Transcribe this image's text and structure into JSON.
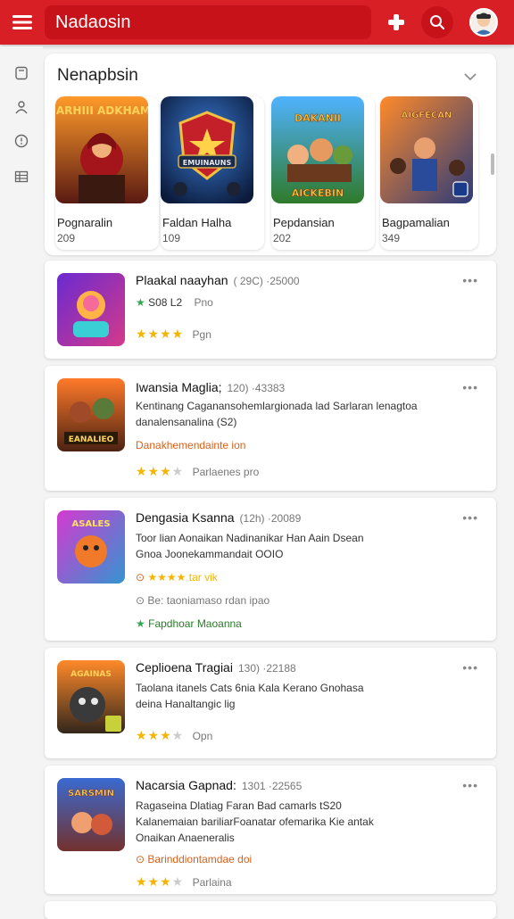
{
  "header": {
    "search_text": "Nadaosin",
    "menu_icon": "hamburger-menu-icon",
    "action_icon": "plus-icon",
    "search_icon": "search-icon",
    "brand_color": "#d81f26"
  },
  "featured": {
    "title": "Nenapbsin",
    "tiles": [
      {
        "name": "Pognaralin",
        "number": "209",
        "art_text": "NEARHIII ADKHAMHI"
      },
      {
        "name": "Faldan Halha",
        "number": "109",
        "art_text": "EMUINAUNS"
      },
      {
        "name": "Pepdansian",
        "number": "202",
        "art_text": "DAKANII AICKEBIN"
      },
      {
        "name": "Bagpamalian",
        "number": "349",
        "art_text": "AIGFECAN"
      }
    ]
  },
  "list": [
    {
      "title": "Plaakal naayhan",
      "meta": "( 29C)  ·25000",
      "rating_text": "S08 L2",
      "extra": "Pno",
      "stars_label": "Pgn"
    },
    {
      "title": "Iwansia Maglia;",
      "meta": "120)  ·43383",
      "desc1": "Kentinang Caganansohemlargionada lad Sarlaran lenagtoa",
      "desc2": "danalensanalina (S2)",
      "highlight": "Danakhemendainte ion",
      "stars_label": "Parlaenes pro"
    },
    {
      "title": "Dengasia Ksanna",
      "meta": "(12h)  ·20089",
      "desc1": "Toor lian Aonaikan Nadinanikar Han Aain Dsean",
      "desc2": "Gnoa Joonekammandait OOIO",
      "rating_line": "★★★★  tar  vik",
      "sub": "Be: taoniamaso rdan ipao",
      "badge": "Fapdhoar Maoanna"
    },
    {
      "title": "Ceplioena Tragiai",
      "meta": "130)  ·22188",
      "desc1": "Taolana itanels Cats 6nia Kala Kerano Gnohasa",
      "desc2": "deina Hanaltangic lig",
      "stars_label": "Opn"
    },
    {
      "title": "Nacarsia Gapnad:",
      "meta": "1301  ·22565",
      "desc1": "Ragaseina Dlatiag Faran Bad camarls tS20",
      "desc2": "Kalanemaian bariliarFoanatar ofemarika Kie antak",
      "desc3": "Onaikan Anaeneralis",
      "highlight": "Barinddiontamdae doi",
      "stars_label": "Parlaina"
    }
  ]
}
